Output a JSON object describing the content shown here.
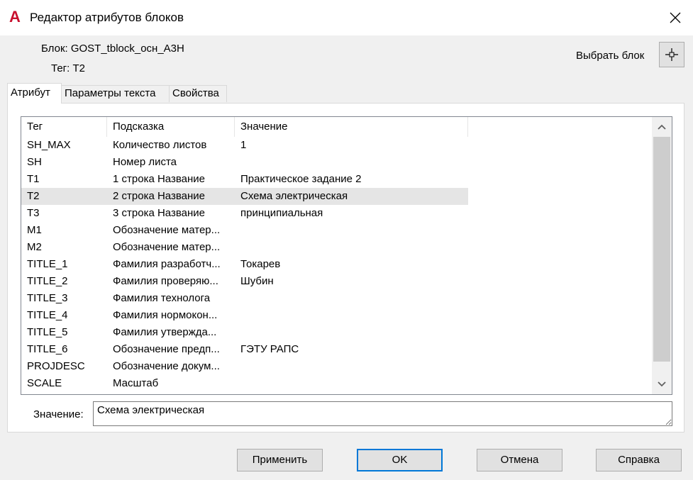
{
  "window": {
    "title": "Редактор атрибутов блоков",
    "icon": "autocad-logo-icon",
    "icon_letter": "A",
    "accent_color": "#c8102e"
  },
  "info": {
    "block_line": "Блок: GOST_tblock_осн_A3H",
    "tag_line": "Тег: T2",
    "pick_block_label": "Выбрать блок"
  },
  "tabs": [
    {
      "label": "Атрибут",
      "active": true
    },
    {
      "label": "Параметры текста",
      "active": false
    },
    {
      "label": "Свойства",
      "active": false
    }
  ],
  "table": {
    "headers": [
      "Тег",
      "Подсказка",
      "Значение"
    ],
    "rows": [
      {
        "tag": "SH_MAX",
        "prompt": "Количество листов",
        "value": "1"
      },
      {
        "tag": "SH",
        "prompt": "Номер листа",
        "value": ""
      },
      {
        "tag": "T1",
        "prompt": "1 строка Название",
        "value": "Практическое задание 2"
      },
      {
        "tag": "T2",
        "prompt": "2 строка Название",
        "value": "Схема электрическая",
        "selected": true
      },
      {
        "tag": "T3",
        "prompt": "3 строка Название",
        "value": "принципиальная"
      },
      {
        "tag": "M1",
        "prompt": "Обозначение матер...",
        "value": ""
      },
      {
        "tag": "M2",
        "prompt": "Обозначение матер...",
        "value": ""
      },
      {
        "tag": "TITLE_1",
        "prompt": "Фамилия разработч...",
        "value": "Токарев"
      },
      {
        "tag": "TITLE_2",
        "prompt": "Фамилия проверяю...",
        "value": "Шубин"
      },
      {
        "tag": "TITLE_3",
        "prompt": "Фамилия технолога",
        "value": ""
      },
      {
        "tag": "TITLE_4",
        "prompt": "Фамилия нормокон...",
        "value": ""
      },
      {
        "tag": "TITLE_5",
        "prompt": "Фамилия утвержда...",
        "value": ""
      },
      {
        "tag": "TITLE_6",
        "prompt": "Обозначение предп...",
        "value": "ГЭТУ РАПС"
      },
      {
        "tag": "PROJDESC",
        "prompt": "Обозначение докум...",
        "value": ""
      },
      {
        "tag": "SCALE",
        "prompt": "Масштаб",
        "value": ""
      }
    ]
  },
  "value_field": {
    "label": "Значение:",
    "value": "Схема электрическая"
  },
  "buttons": {
    "apply": "Применить",
    "ok": "OK",
    "cancel": "Отмена",
    "help": "Справка"
  }
}
